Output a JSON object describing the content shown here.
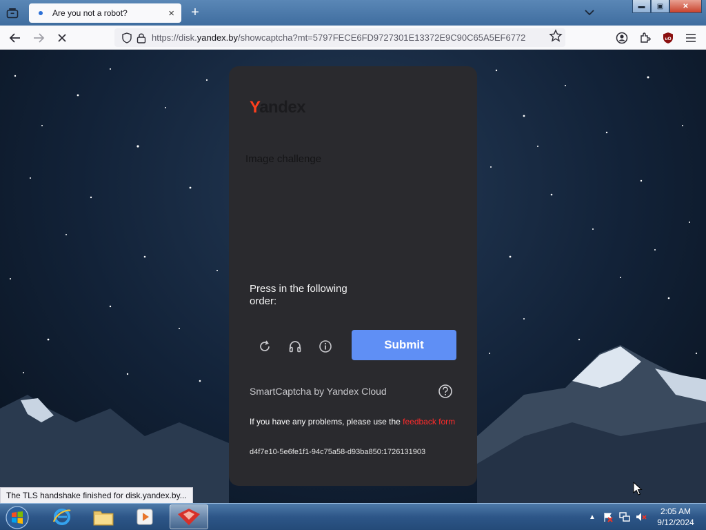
{
  "browser": {
    "tab_title": "Are you not a robot?",
    "tab_close": "×",
    "new_tab": "+",
    "url_prefix": "https://disk.",
    "url_host": "yandex.by",
    "url_path": "/showcaptcha?mt=5797FECE6FD9727301E13372E9C90C65A5EF6772",
    "status_text": "The TLS handshake finished for disk.yandex.by..."
  },
  "window_controls": {
    "minimize": "▬",
    "maximize": "▣",
    "close": "✕"
  },
  "captcha": {
    "logo_first": "Y",
    "logo_rest": "andex",
    "challenge_text": "Image challenge",
    "order_label": "Press in the following order:",
    "submit_label": "Submit",
    "brand_text": "SmartCaptcha by Yandex Cloud",
    "problems_text": "If you have any problems, please use the ",
    "feedback_link": "feedback form",
    "token": "d4f7e10-5e6fe1f1-94c75a58-d93ba850:1726131903"
  },
  "taskbar": {
    "time": "2:05 AM",
    "date": "9/12/2024"
  },
  "colors": {
    "submit": "#5f8ff5",
    "card": "#2a2a2e",
    "yandex_red": "#fc3f1d",
    "link_red": "#ff2b2b"
  },
  "icons": [
    "tab-list-icon",
    "back-icon",
    "forward-icon",
    "stop-icon",
    "shield-icon",
    "lock-icon",
    "star-icon",
    "account-icon",
    "extensions-icon",
    "ublock-icon",
    "menu-icon",
    "refresh-icon",
    "headphones-icon",
    "info-icon",
    "help-icon",
    "windows-start-icon",
    "ie-icon",
    "explorer-icon",
    "media-player-icon",
    "app-icon",
    "flag-icon",
    "network-icon",
    "volume-muted-icon"
  ]
}
